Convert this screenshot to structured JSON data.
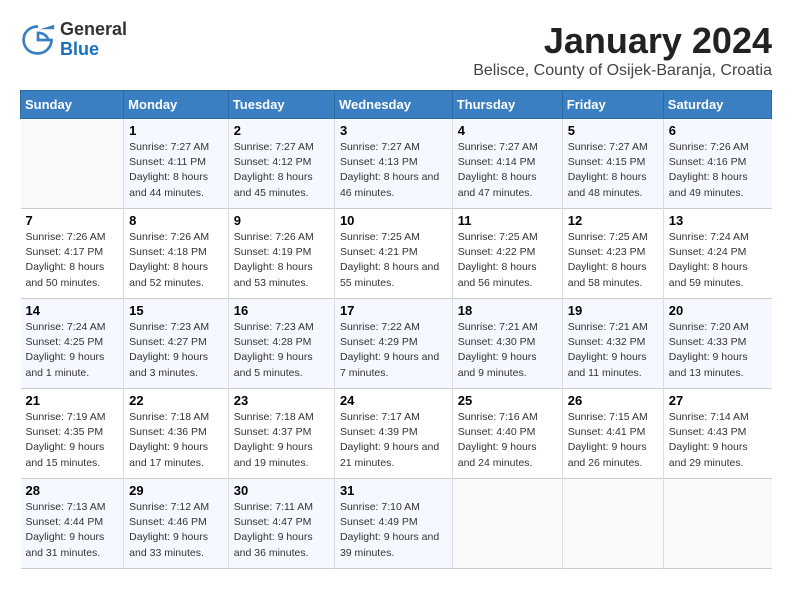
{
  "header": {
    "logo_general": "General",
    "logo_blue": "Blue",
    "month_year": "January 2024",
    "location": "Belisce, County of Osijek-Baranja, Croatia"
  },
  "columns": [
    "Sunday",
    "Monday",
    "Tuesday",
    "Wednesday",
    "Thursday",
    "Friday",
    "Saturday"
  ],
  "weeks": [
    [
      {
        "day": "",
        "empty": true
      },
      {
        "day": "1",
        "sunrise": "7:27 AM",
        "sunset": "4:11 PM",
        "daylight": "8 hours and 44 minutes."
      },
      {
        "day": "2",
        "sunrise": "7:27 AM",
        "sunset": "4:12 PM",
        "daylight": "8 hours and 45 minutes."
      },
      {
        "day": "3",
        "sunrise": "7:27 AM",
        "sunset": "4:13 PM",
        "daylight": "8 hours and 46 minutes."
      },
      {
        "day": "4",
        "sunrise": "7:27 AM",
        "sunset": "4:14 PM",
        "daylight": "8 hours and 47 minutes."
      },
      {
        "day": "5",
        "sunrise": "7:27 AM",
        "sunset": "4:15 PM",
        "daylight": "8 hours and 48 minutes."
      },
      {
        "day": "6",
        "sunrise": "7:26 AM",
        "sunset": "4:16 PM",
        "daylight": "8 hours and 49 minutes."
      }
    ],
    [
      {
        "day": "7",
        "sunrise": "7:26 AM",
        "sunset": "4:17 PM",
        "daylight": "8 hours and 50 minutes."
      },
      {
        "day": "8",
        "sunrise": "7:26 AM",
        "sunset": "4:18 PM",
        "daylight": "8 hours and 52 minutes."
      },
      {
        "day": "9",
        "sunrise": "7:26 AM",
        "sunset": "4:19 PM",
        "daylight": "8 hours and 53 minutes."
      },
      {
        "day": "10",
        "sunrise": "7:25 AM",
        "sunset": "4:21 PM",
        "daylight": "8 hours and 55 minutes."
      },
      {
        "day": "11",
        "sunrise": "7:25 AM",
        "sunset": "4:22 PM",
        "daylight": "8 hours and 56 minutes."
      },
      {
        "day": "12",
        "sunrise": "7:25 AM",
        "sunset": "4:23 PM",
        "daylight": "8 hours and 58 minutes."
      },
      {
        "day": "13",
        "sunrise": "7:24 AM",
        "sunset": "4:24 PM",
        "daylight": "8 hours and 59 minutes."
      }
    ],
    [
      {
        "day": "14",
        "sunrise": "7:24 AM",
        "sunset": "4:25 PM",
        "daylight": "9 hours and 1 minute."
      },
      {
        "day": "15",
        "sunrise": "7:23 AM",
        "sunset": "4:27 PM",
        "daylight": "9 hours and 3 minutes."
      },
      {
        "day": "16",
        "sunrise": "7:23 AM",
        "sunset": "4:28 PM",
        "daylight": "9 hours and 5 minutes."
      },
      {
        "day": "17",
        "sunrise": "7:22 AM",
        "sunset": "4:29 PM",
        "daylight": "9 hours and 7 minutes."
      },
      {
        "day": "18",
        "sunrise": "7:21 AM",
        "sunset": "4:30 PM",
        "daylight": "9 hours and 9 minutes."
      },
      {
        "day": "19",
        "sunrise": "7:21 AM",
        "sunset": "4:32 PM",
        "daylight": "9 hours and 11 minutes."
      },
      {
        "day": "20",
        "sunrise": "7:20 AM",
        "sunset": "4:33 PM",
        "daylight": "9 hours and 13 minutes."
      }
    ],
    [
      {
        "day": "21",
        "sunrise": "7:19 AM",
        "sunset": "4:35 PM",
        "daylight": "9 hours and 15 minutes."
      },
      {
        "day": "22",
        "sunrise": "7:18 AM",
        "sunset": "4:36 PM",
        "daylight": "9 hours and 17 minutes."
      },
      {
        "day": "23",
        "sunrise": "7:18 AM",
        "sunset": "4:37 PM",
        "daylight": "9 hours and 19 minutes."
      },
      {
        "day": "24",
        "sunrise": "7:17 AM",
        "sunset": "4:39 PM",
        "daylight": "9 hours and 21 minutes."
      },
      {
        "day": "25",
        "sunrise": "7:16 AM",
        "sunset": "4:40 PM",
        "daylight": "9 hours and 24 minutes."
      },
      {
        "day": "26",
        "sunrise": "7:15 AM",
        "sunset": "4:41 PM",
        "daylight": "9 hours and 26 minutes."
      },
      {
        "day": "27",
        "sunrise": "7:14 AM",
        "sunset": "4:43 PM",
        "daylight": "9 hours and 29 minutes."
      }
    ],
    [
      {
        "day": "28",
        "sunrise": "7:13 AM",
        "sunset": "4:44 PM",
        "daylight": "9 hours and 31 minutes."
      },
      {
        "day": "29",
        "sunrise": "7:12 AM",
        "sunset": "4:46 PM",
        "daylight": "9 hours and 33 minutes."
      },
      {
        "day": "30",
        "sunrise": "7:11 AM",
        "sunset": "4:47 PM",
        "daylight": "9 hours and 36 minutes."
      },
      {
        "day": "31",
        "sunrise": "7:10 AM",
        "sunset": "4:49 PM",
        "daylight": "9 hours and 39 minutes."
      },
      {
        "day": "",
        "empty": true
      },
      {
        "day": "",
        "empty": true
      },
      {
        "day": "",
        "empty": true
      }
    ]
  ]
}
